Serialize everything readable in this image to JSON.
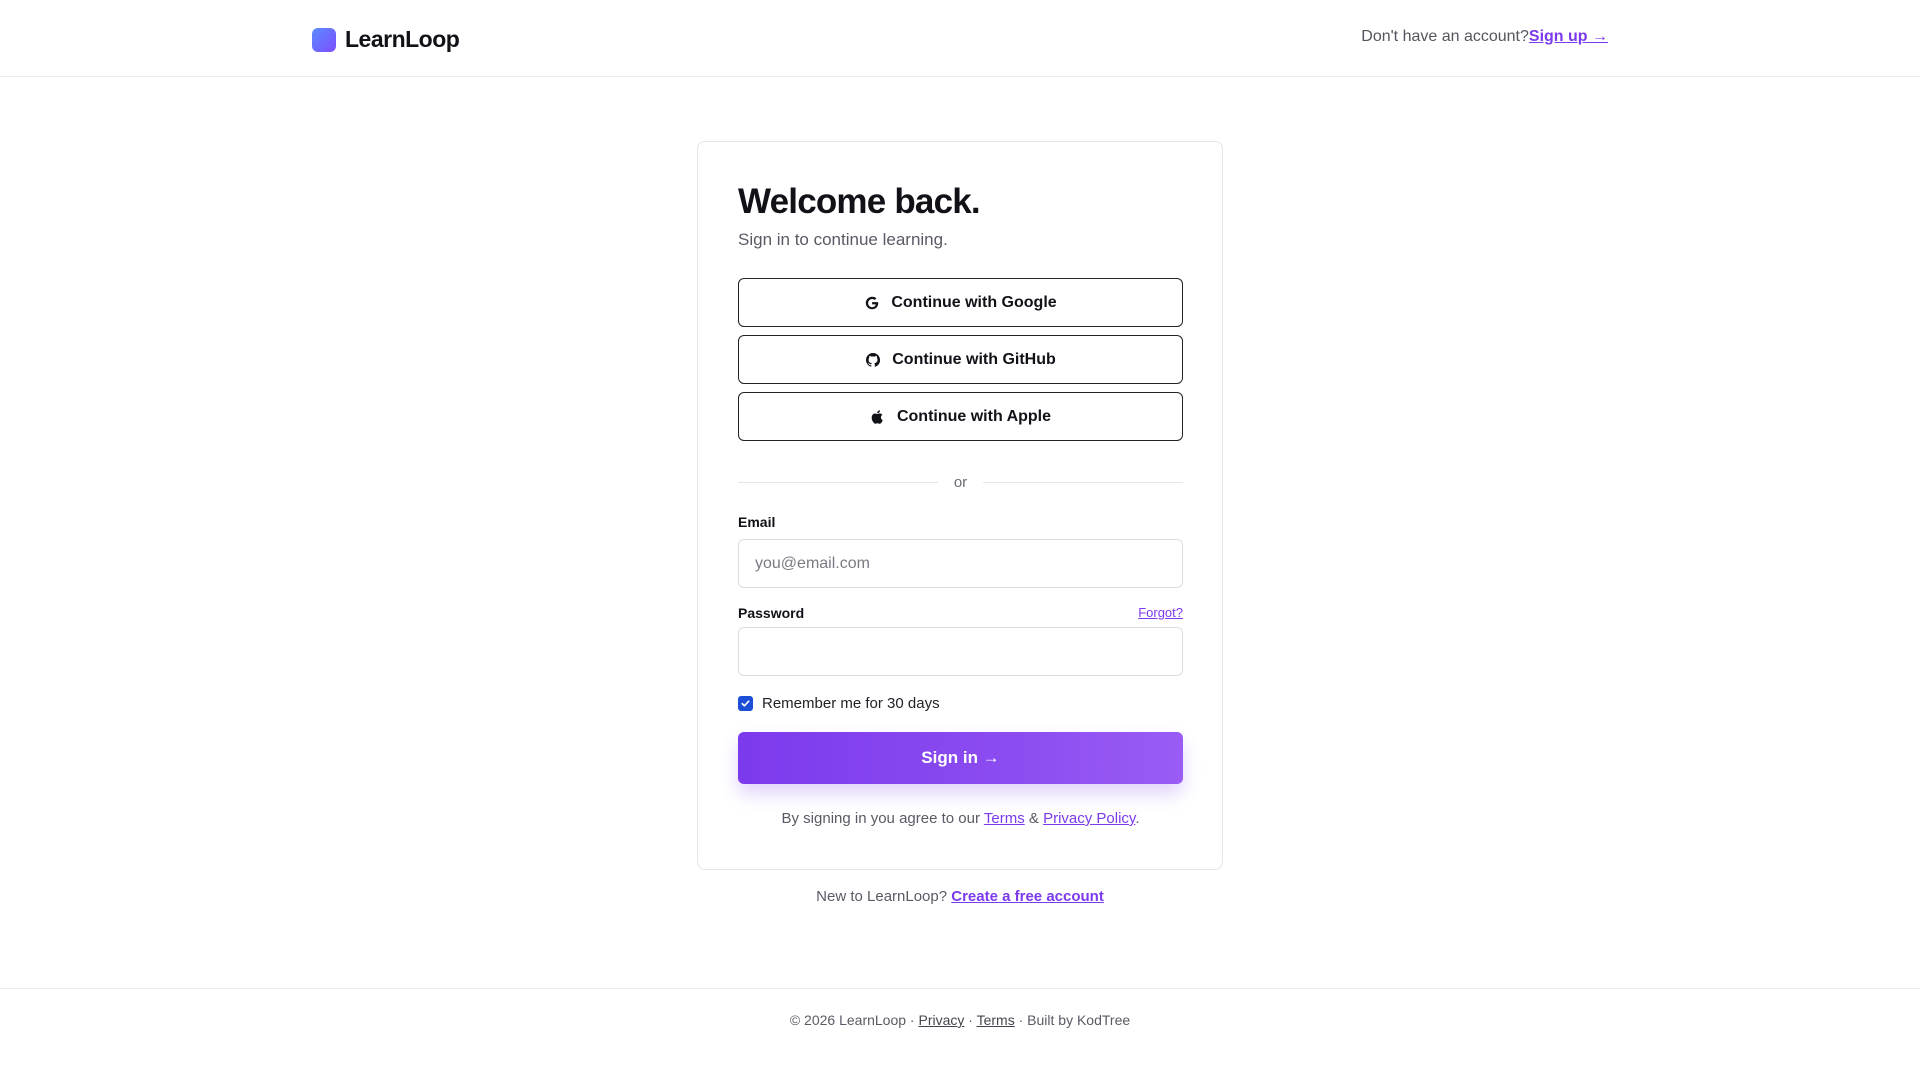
{
  "header": {
    "brand": "LearnLoop",
    "no_account_text": "Don't have an account?",
    "signup_link": "Sign up →"
  },
  "card": {
    "title": "Welcome back.",
    "subtitle": "Sign in to continue learning.",
    "oauth": {
      "google": "Continue with Google",
      "github": "Continue with GitHub",
      "apple": "Continue with Apple"
    },
    "divider": "or",
    "email": {
      "label": "Email",
      "placeholder": "you@email.com",
      "value": ""
    },
    "password": {
      "label": "Password",
      "forgot": "Forgot?",
      "value": ""
    },
    "remember": {
      "label": "Remember me for 30 days",
      "checked": true
    },
    "signin_button": "Sign in →",
    "agree": {
      "prefix": "By signing in you agree to our",
      "terms": "Terms",
      "amp": "&",
      "privacy": "Privacy Policy",
      "suffix": "."
    }
  },
  "new_to": {
    "text": "New to LearnLoop?",
    "link": "Create a free account"
  },
  "footer": {
    "copyright": "© 2026 LearnLoop ·",
    "privacy": "Privacy",
    "sep": "·",
    "terms": "Terms",
    "built": "· Built by KodTree"
  },
  "colors": {
    "accent": "#7c3aed",
    "checkbox": "#1d4ed8",
    "logo_gradient_start": "#5b8cff",
    "logo_gradient_end": "#7c4dff"
  },
  "icons": {
    "google": "google-icon",
    "github": "github-icon",
    "apple": "apple-icon",
    "check": "check-icon"
  }
}
